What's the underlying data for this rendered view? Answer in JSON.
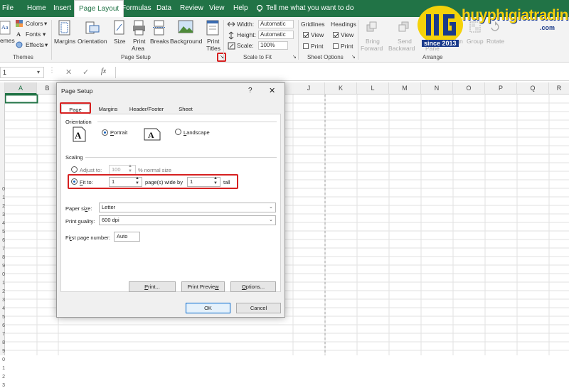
{
  "menu": {
    "items": [
      "File",
      "Home",
      "Insert",
      "Page Layout",
      "Formulas",
      "Data",
      "Review",
      "View",
      "Help"
    ],
    "tell_me": "Tell me what you want to do",
    "active": "Page Layout"
  },
  "ribbon": {
    "themes": {
      "label": "Themes",
      "themes_btn": "emes",
      "colors": "Colors",
      "fonts": "Fonts",
      "effects": "Effects"
    },
    "page_setup": {
      "label": "Page Setup",
      "margins": "Margins",
      "orientation": "Orientation",
      "size": "Size",
      "print_area_1": "Print",
      "print_area_2": "Area",
      "breaks": "Breaks",
      "background": "Background",
      "print_titles_1": "Print",
      "print_titles_2": "Titles"
    },
    "scale_to_fit": {
      "label": "Scale to Fit",
      "width_label": "Width:",
      "width_value": "Automatic",
      "height_label": "Height:",
      "height_value": "Automatic",
      "scale_label": "Scale:",
      "scale_value": "100%"
    },
    "sheet_options": {
      "label": "Sheet Options",
      "gridlines": "Gridlines",
      "headings": "Headings",
      "view": "View",
      "print": "Print"
    },
    "arrange": {
      "label": "Arrange",
      "bring_forward_1": "Bring",
      "bring_forward_2": "Forward",
      "send_backward_1": "Send",
      "send_backward_2": "Backward",
      "selection_pane": "Pane",
      "align": "Align",
      "group": "Group",
      "rotate": "Rotate"
    }
  },
  "watermark": {
    "brand": "huyphigiatrading",
    "domain": ".com",
    "since": "since 2013"
  },
  "formula_bar": {
    "name_box": "1",
    "fx": "fx"
  },
  "columns": [
    "A",
    "B",
    "J",
    "K",
    "L",
    "M",
    "N",
    "O",
    "P",
    "Q",
    "R"
  ],
  "rows": [
    "0",
    "1",
    "2",
    "3",
    "4",
    "5",
    "6",
    "7",
    "8",
    "9",
    "0",
    "1",
    "2",
    "3",
    "4",
    "5",
    "6",
    "7",
    "8",
    "9",
    "0",
    "1",
    "2",
    "3"
  ],
  "dialog": {
    "title": "Page Setup",
    "help": "?",
    "close": "✕",
    "tabs": [
      "Page",
      "Margins",
      "Header/Footer",
      "Sheet"
    ],
    "orientation_label": "Orientation",
    "portrait": "Portrait",
    "landscape": "Landscape",
    "scaling_label": "Scaling",
    "adjust_to": "Adjust to:",
    "adjust_value": "100",
    "normal_size": "% normal size",
    "fit_to": "Fit to:",
    "fit_wide_value": "1",
    "pages_wide_by": "page(s) wide by",
    "fit_tall_value": "1",
    "tall": "tall",
    "paper_size_label": "Paper size:",
    "paper_size_value": "Letter",
    "print_quality_label": "Print quality:",
    "print_quality_value": "600 dpi",
    "first_page_label": "First page number:",
    "first_page_value": "Auto",
    "print_btn": "Print...",
    "preview_btn": "Print Preview",
    "options_btn": "Options...",
    "ok_btn": "OK",
    "cancel_btn": "Cancel"
  },
  "colors": {
    "excel_green": "#217346",
    "highlight": "#d62020",
    "brand_blue": "#1a3a8a",
    "brand_yellow": "#f5d20a"
  }
}
